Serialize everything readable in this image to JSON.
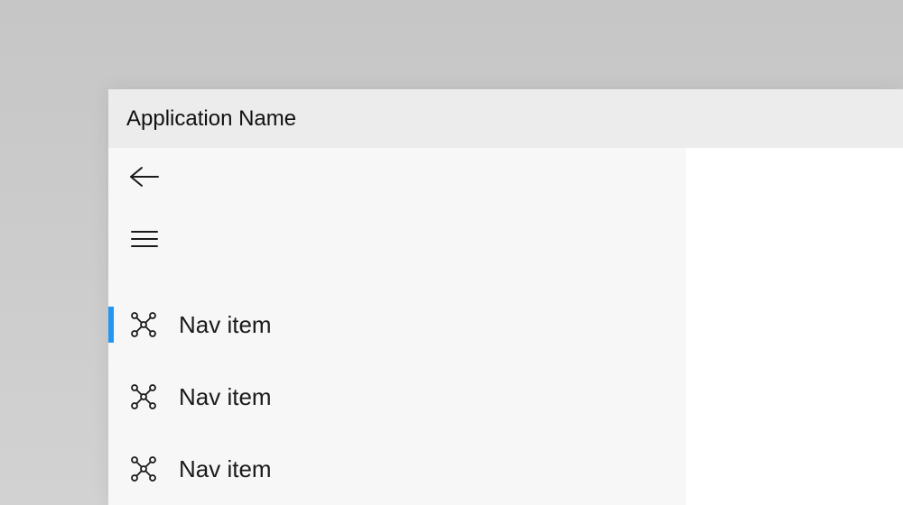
{
  "titlebar": {
    "title": "Application Name"
  },
  "nav": {
    "items": [
      {
        "label": "Nav item",
        "selected": true
      },
      {
        "label": "Nav item",
        "selected": false
      },
      {
        "label": "Nav item",
        "selected": false
      }
    ]
  },
  "colors": {
    "accent": "#2196f3"
  }
}
